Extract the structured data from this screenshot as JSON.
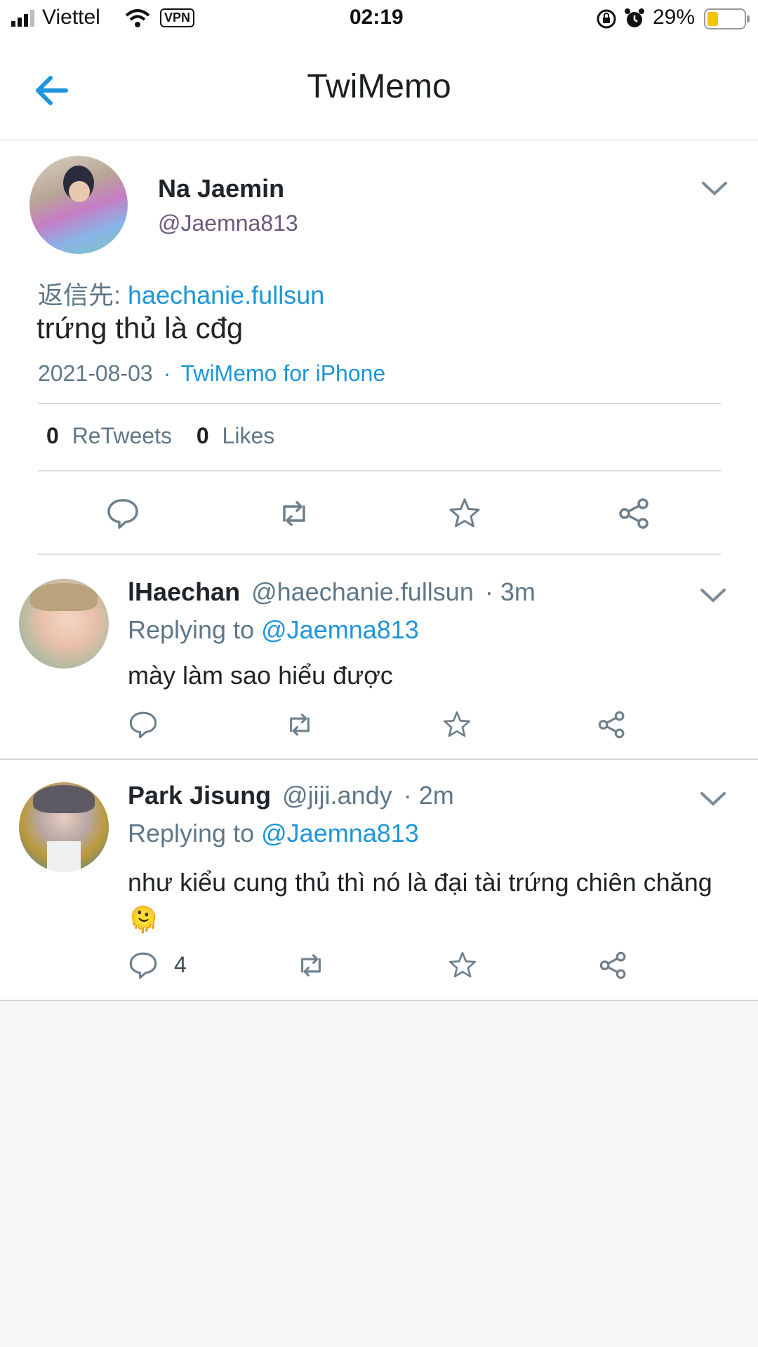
{
  "status": {
    "carrier": "Viettel",
    "vpn": "VPN",
    "time": "02:19",
    "battery": "29%"
  },
  "header": {
    "title": "TwiMemo",
    "back_icon": "arrow-left-icon"
  },
  "tweet": {
    "name": "Na Jaemin",
    "handle": "@Jaemna813",
    "reply_to_label": "返信先:",
    "reply_to_user": "haechanie.fullsun",
    "text": "trứng thủ là cđg",
    "date": "2021-08-03",
    "separator": "·",
    "source": "TwiMemo for iPhone",
    "retweets_count": "0",
    "retweets_label": "ReTweets",
    "likes_count": "0",
    "likes_label": "Likes"
  },
  "replies": [
    {
      "name": "lHaechan",
      "handle": "@haechanie.fullsun",
      "time": "· 3m",
      "replying_label": "Replying to",
      "replying_user": "@Jaemna813",
      "text": "mày làm sao hiểu được",
      "reply_count": ""
    },
    {
      "name": "Park Jisung",
      "handle": "@jiji.andy",
      "time": "· 2m",
      "replying_label": "Replying to",
      "replying_user": "@Jaemna813",
      "text": "như kiểu cung thủ thì nó là đại tài trứng chiên chăng 🫠",
      "reply_count": "4"
    }
  ],
  "colors": {
    "accent": "#1d95d8",
    "muted": "#5f7787",
    "icon": "#6e7f8c",
    "background": "#f7f7f7"
  }
}
